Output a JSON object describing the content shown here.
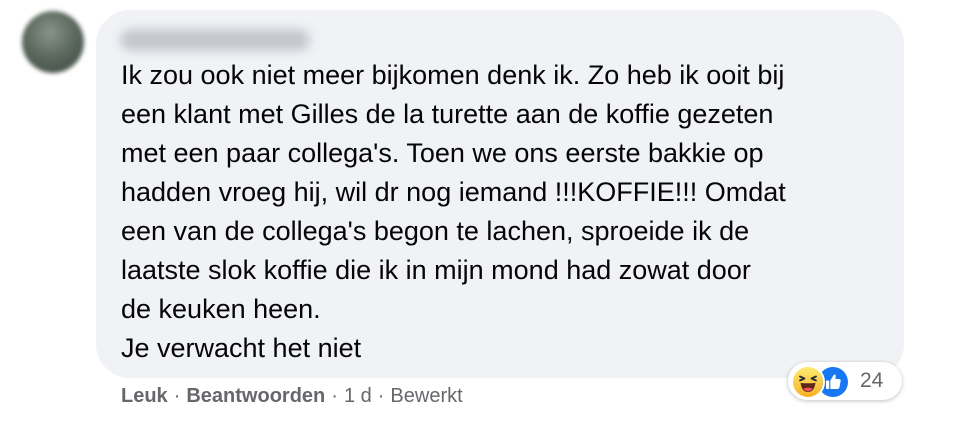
{
  "comment": {
    "text": "Ik zou ook niet meer bijkomen denk ik. Zo heb ik ooit bij\neen klant met Gilles de la turette aan de koffie gezeten\nmet een paar collega's. Toen we ons eerste bakkie op\nhadden vroeg hij, wil dr nog iemand !!!KOFFIE!!! Omdat\neen van de collega's begon te lachen, sproeide ik de\nlaatste slok koffie die ik in mijn mond had zowat door\nde keuken heen.\nJe verwacht het niet"
  },
  "reactions": {
    "icons": [
      "haha-icon",
      "like-icon"
    ],
    "count": "24"
  },
  "actions": {
    "like_label": "Leuk",
    "reply_label": "Beantwoorden",
    "separator": "·",
    "time": "1 d",
    "edited": "Bewerkt"
  },
  "colors": {
    "bubble": "#f0f2f5",
    "meta_text": "#65676b",
    "like_blue": "#1877f2",
    "haha_yellow": "#f7b125"
  }
}
